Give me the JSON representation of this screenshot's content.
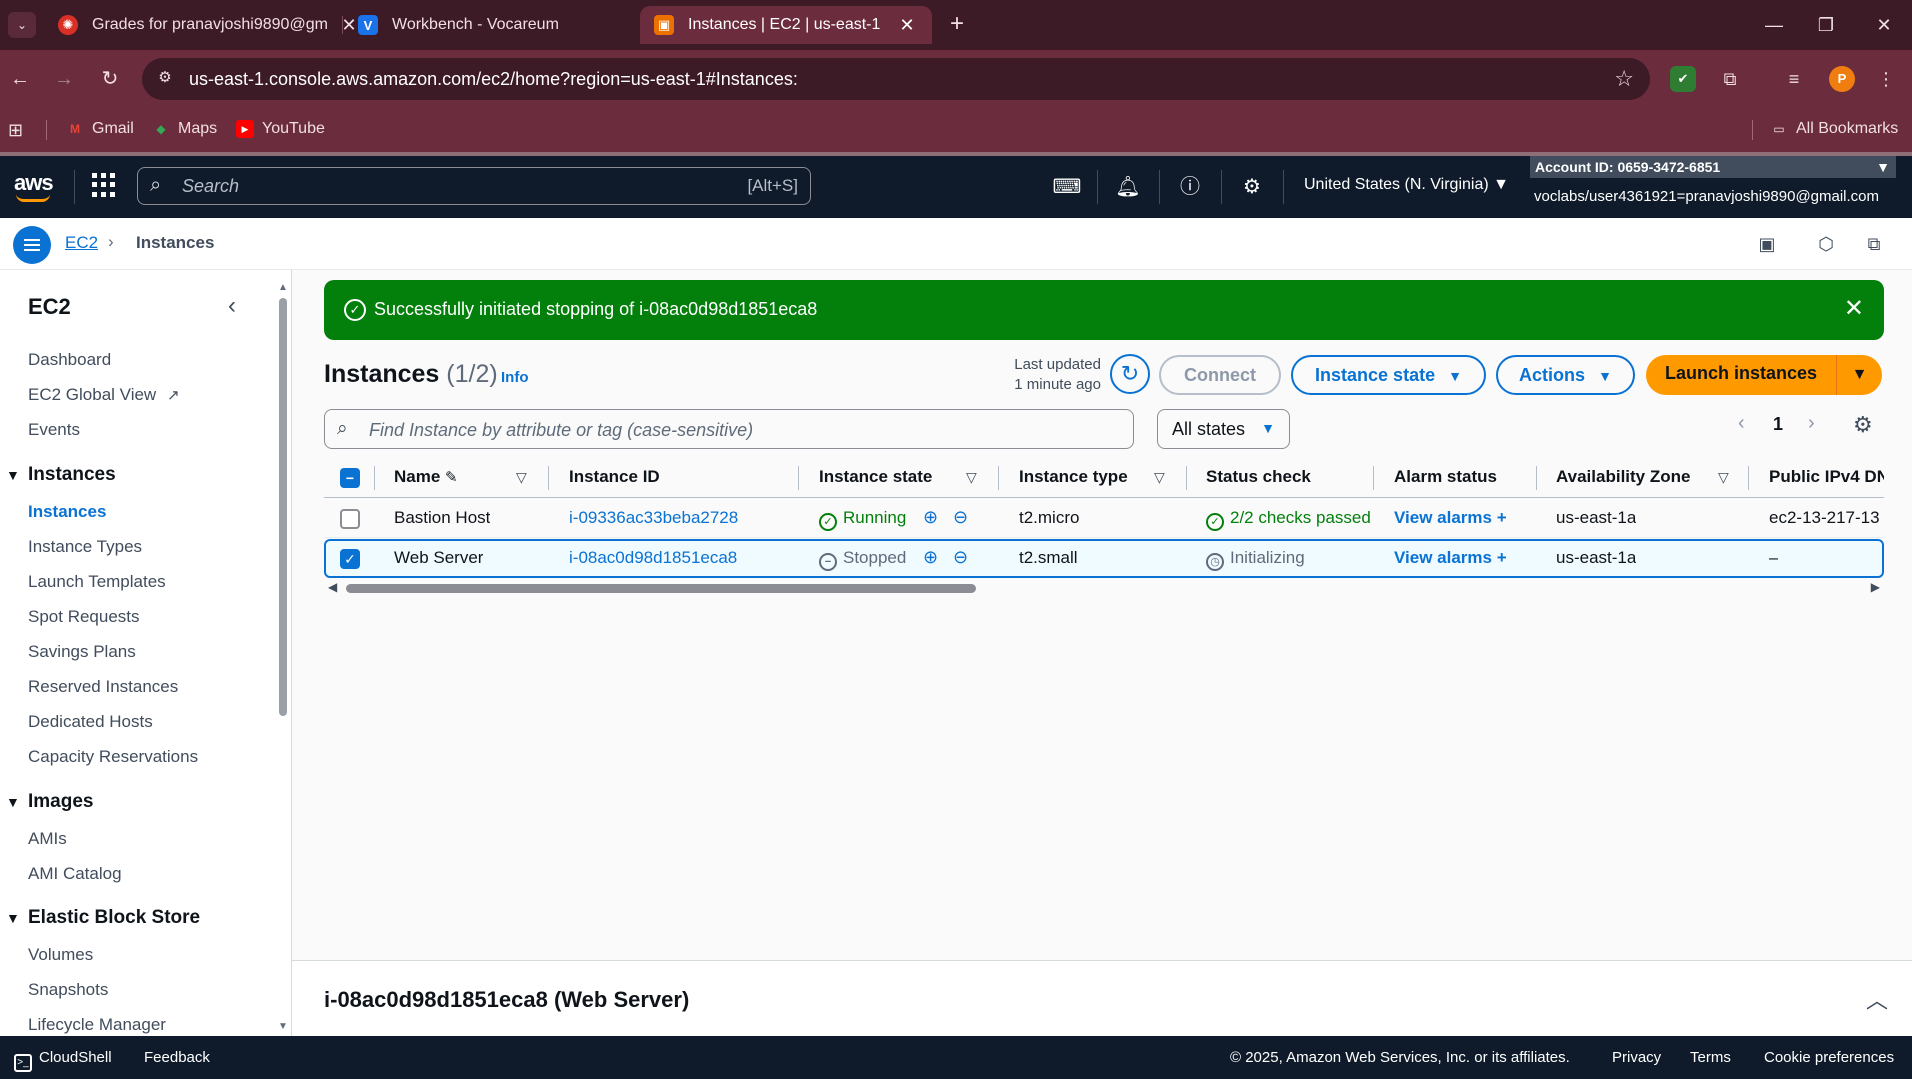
{
  "browser": {
    "tabs": [
      {
        "title": "Grades for pranavjoshi9890@gm",
        "favicon": "canvas-icon",
        "active": false
      },
      {
        "title": "Workbench - Vocareum",
        "favicon": "vocareum-icon",
        "active": false
      },
      {
        "title": "Instances | EC2 | us-east-1",
        "favicon": "aws-ec2-icon",
        "active": true
      }
    ],
    "url": "us-east-1.console.aws.amazon.com/ec2/home?region=us-east-1#Instances:",
    "profile_initial": "P",
    "bookmarks": [
      {
        "label": "Gmail",
        "icon": "gmail-icon"
      },
      {
        "label": "Maps",
        "icon": "maps-icon"
      },
      {
        "label": "YouTube",
        "icon": "youtube-icon"
      }
    ],
    "all_bookmarks": "All Bookmarks"
  },
  "aws_header": {
    "logo": "aws",
    "search_placeholder": "Search",
    "search_shortcut": "[Alt+S]",
    "region": "United States (N. Virginia) ▼",
    "account": "Account ID: 0659-3472-6851",
    "user": "voclabs/user4361921=pranavjoshi9890@gmail.com"
  },
  "breadcrumb": {
    "root": "EC2",
    "current": "Instances"
  },
  "sidenav": {
    "title": "EC2",
    "top_items": [
      "Dashboard",
      "EC2 Global View",
      "Events"
    ],
    "sections": [
      {
        "title": "Instances",
        "items": [
          "Instances",
          "Instance Types",
          "Launch Templates",
          "Spot Requests",
          "Savings Plans",
          "Reserved Instances",
          "Dedicated Hosts",
          "Capacity Reservations"
        ]
      },
      {
        "title": "Images",
        "items": [
          "AMIs",
          "AMI Catalog"
        ]
      },
      {
        "title": "Elastic Block Store",
        "items": [
          "Volumes",
          "Snapshots",
          "Lifecycle Manager"
        ]
      }
    ],
    "active_item": "Instances"
  },
  "flash": {
    "message": "Successfully initiated stopping of i-08ac0d98d1851eca8",
    "color": "#037f0c"
  },
  "page": {
    "title": "Instances",
    "count": "(1/2)",
    "info": "Info",
    "last_updated_1": "Last updated",
    "last_updated_2": "1 minute ago",
    "buttons": {
      "connect": "Connect",
      "instance_state": "Instance state",
      "actions": "Actions",
      "launch": "Launch instances"
    },
    "find_placeholder": "Find Instance by attribute or tag (case-sensitive)",
    "state_filter": "All states",
    "page_number": "1"
  },
  "table": {
    "columns": [
      "Name",
      "Instance ID",
      "Instance state",
      "Instance type",
      "Status check",
      "Alarm status",
      "Availability Zone",
      "Public IPv4 DNS"
    ],
    "rows": [
      {
        "name": "Bastion Host",
        "id": "i-09336ac33beba2728",
        "state": "Running",
        "type": "t2.micro",
        "status": "2/2 checks passed",
        "alarm": "View alarms",
        "az": "us-east-1a",
        "dns": "ec2-13-217-13",
        "selected": false
      },
      {
        "name": "Web Server",
        "id": "i-08ac0d98d1851eca8",
        "state": "Stopped",
        "type": "t2.small",
        "status": "Initializing",
        "alarm": "View alarms",
        "az": "us-east-1a",
        "dns": "–",
        "selected": true
      }
    ]
  },
  "split_panel": {
    "title": "i-08ac0d98d1851eca8 (Web Server)"
  },
  "footer": {
    "cloudshell": "CloudShell",
    "feedback": "Feedback",
    "copyright": "© 2025, Amazon Web Services, Inc. or its affiliates.",
    "privacy": "Privacy",
    "terms": "Terms",
    "cookies": "Cookie preferences"
  },
  "colors": {
    "accent": "#0972d3",
    "primary_button": "#ff9900",
    "success": "#037f0c",
    "header_bg": "#0f1b2a"
  }
}
